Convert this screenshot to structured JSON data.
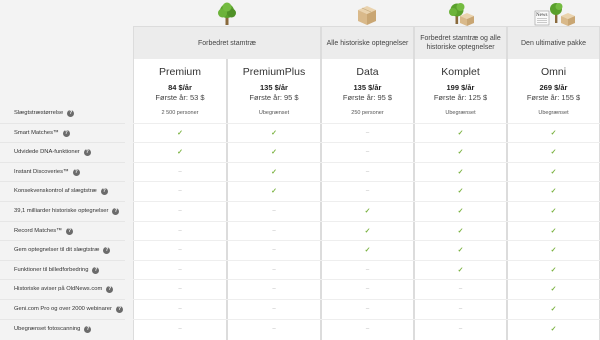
{
  "groups": [
    {
      "label": "Forbedret stamtræ"
    },
    {
      "label": "Alle historiske optegnelser"
    },
    {
      "label": "Forbedret stamtræ og alle historiske optegnelser"
    },
    {
      "label": "Den ultimative pakke"
    }
  ],
  "plans": [
    {
      "name": "Premium",
      "price": "84 $/år",
      "first_year": "Første år: 53 $"
    },
    {
      "name": "PremiumPlus",
      "price": "135 $/år",
      "first_year": "Første år: 95 $"
    },
    {
      "name": "Data",
      "price": "135 $/år",
      "first_year": "Første år: 95 $"
    },
    {
      "name": "Komplet",
      "price": "199 $/år",
      "first_year": "Første år: 125 $"
    },
    {
      "name": "Omni",
      "price": "269 $/år",
      "first_year": "Første år: 155 $"
    }
  ],
  "icons": {
    "tree": "tree-icon",
    "box": "box-icon",
    "newspaper_label": "News"
  },
  "features": [
    {
      "label": "Slægtstræstørrelse",
      "values": [
        "2 500 personer",
        "Ubegrænset",
        "250 personer",
        "Ubegrænset",
        "Ubegrænset"
      ]
    },
    {
      "label": "Smart Matches™",
      "values": [
        "check",
        "check",
        "dash",
        "check",
        "check"
      ]
    },
    {
      "label": "Udvidede DNA-funktioner",
      "values": [
        "check",
        "check",
        "dash",
        "check",
        "check"
      ]
    },
    {
      "label": "Instant Discoveries™",
      "values": [
        "dash",
        "check",
        "dash",
        "check",
        "check"
      ]
    },
    {
      "label": "Konsekvenskontrol af slægtstræ",
      "values": [
        "dash",
        "check",
        "dash",
        "check",
        "check"
      ]
    },
    {
      "label": "39,1 milliarder historiske optegnelser",
      "values": [
        "dash",
        "dash",
        "check",
        "check",
        "check"
      ]
    },
    {
      "label": "Record Matches™",
      "values": [
        "dash",
        "dash",
        "check",
        "check",
        "check"
      ]
    },
    {
      "label": "Gem optegnelser til dit slægtstræ",
      "values": [
        "dash",
        "dash",
        "check",
        "check",
        "check"
      ]
    },
    {
      "label": "Funktioner til billedforbedring",
      "values": [
        "dash",
        "dash",
        "dash",
        "check",
        "check"
      ]
    },
    {
      "label": "Historiske aviser på OldNews.com",
      "values": [
        "dash",
        "dash",
        "dash",
        "dash",
        "check"
      ]
    },
    {
      "label": "Geni.com Pro og over 2000 webinarer",
      "values": [
        "dash",
        "dash",
        "dash",
        "dash",
        "check"
      ]
    },
    {
      "label": "Ubegrænset fotoscanning",
      "values": [
        "dash",
        "dash",
        "dash",
        "dash",
        "check"
      ]
    }
  ],
  "help_glyph": "?",
  "check_glyph": "✓",
  "dash_glyph": "–",
  "colors": {
    "check": "#7cb342",
    "tree": "#5aa02c",
    "trunk": "#8a6a3c",
    "box": "#d9b98a"
  }
}
